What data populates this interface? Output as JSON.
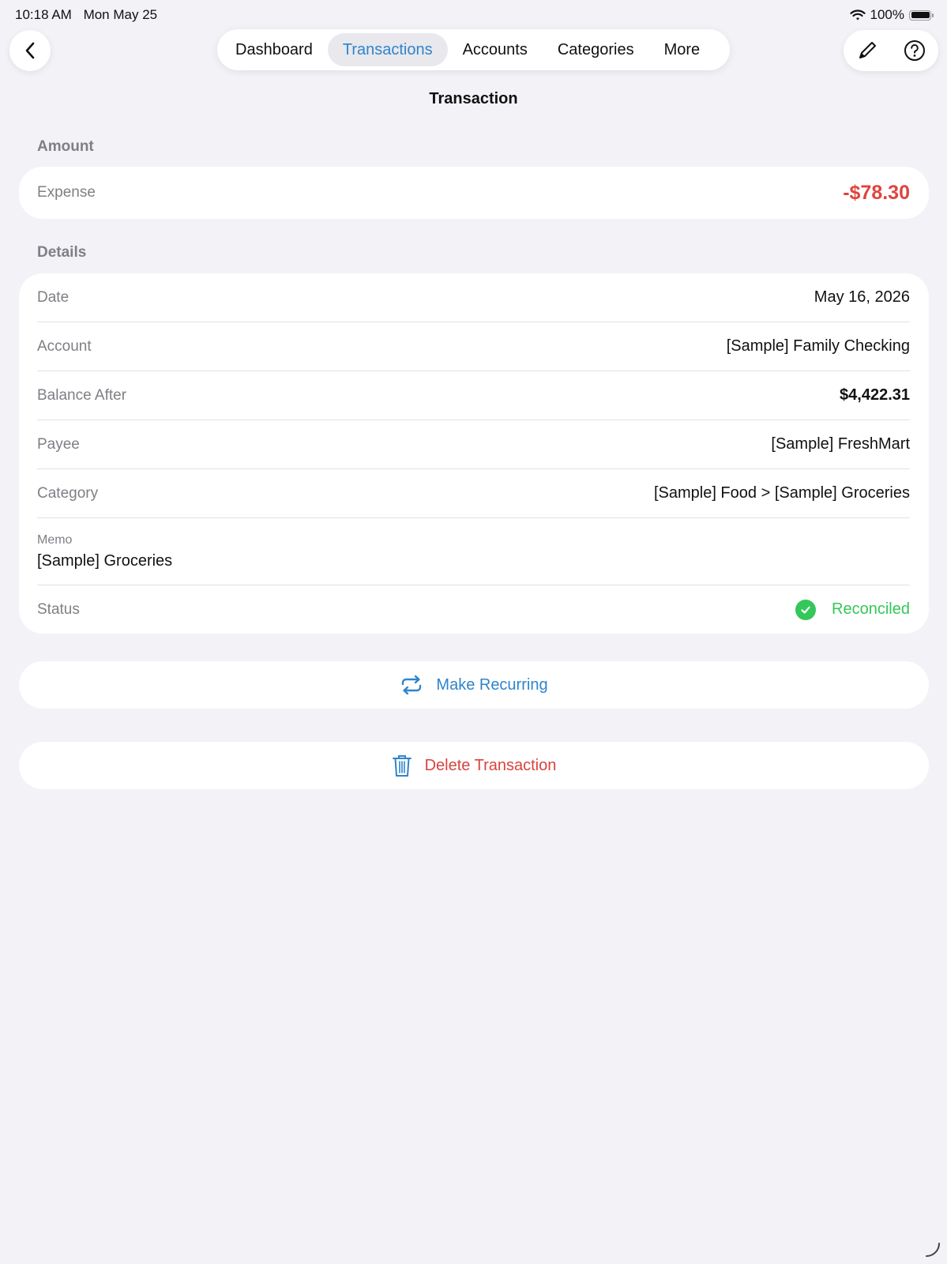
{
  "status_bar": {
    "time": "10:18 AM",
    "date": "Mon May 25",
    "battery": "100%"
  },
  "nav": {
    "tabs": [
      {
        "label": "Dashboard"
      },
      {
        "label": "Transactions"
      },
      {
        "label": "Accounts"
      },
      {
        "label": "Categories"
      },
      {
        "label": "More"
      }
    ],
    "active_tab": "Transactions"
  },
  "page": {
    "title": "Transaction"
  },
  "amount_section": {
    "label": "Amount",
    "type": "Expense",
    "value": "-$78.30"
  },
  "details_section": {
    "label": "Details",
    "rows": [
      {
        "label": "Date",
        "value": "May 16, 2026"
      },
      {
        "label": "Account",
        "value": "[Sample] Family Checking"
      },
      {
        "label": "Balance After",
        "value": "$4,422.31"
      },
      {
        "label": "Payee",
        "value": "[Sample] FreshMart"
      },
      {
        "label": "Category",
        "value": "[Sample] Food > [Sample] Groceries"
      }
    ],
    "memo": {
      "label": "Memo",
      "value": "[Sample] Groceries"
    },
    "status": {
      "label": "Status",
      "value": "Reconciled"
    }
  },
  "actions": {
    "make_recurring": "Make Recurring",
    "delete": "Delete Transaction"
  },
  "icons": {
    "back": "chevron-left-icon",
    "edit": "pencil-icon",
    "help": "question-circle-icon",
    "recurring": "repeat-icon",
    "delete": "trash-icon",
    "status": "checkmark-circle-icon"
  },
  "colors": {
    "accent": "#2f84cd",
    "expense": "#e0443e",
    "success": "#34c759",
    "background": "#f2f2f7"
  }
}
